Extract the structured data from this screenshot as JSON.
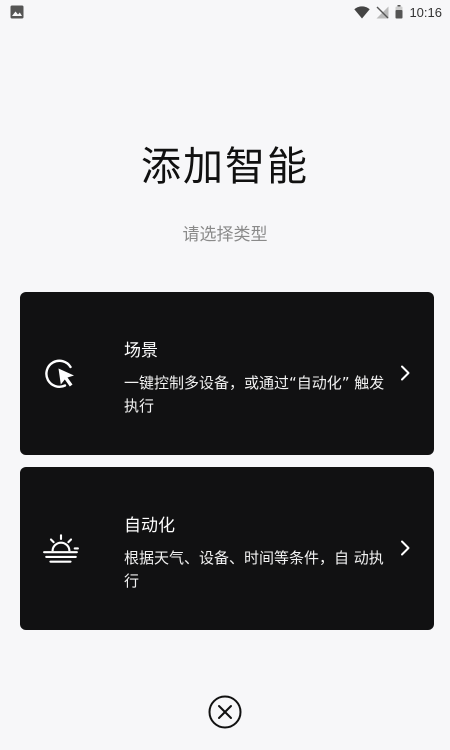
{
  "status_bar": {
    "time": "10:16",
    "icons": [
      "image-notification-icon",
      "wifi-icon",
      "no-signal-icon",
      "battery-icon"
    ]
  },
  "header": {
    "title": "添加智能",
    "subtitle": "请选择类型"
  },
  "options": [
    {
      "title": "场景",
      "description": "一键控制多设备，或通过“自动化” 触发执行",
      "icon": "cursor-click-icon"
    },
    {
      "title": "自动化",
      "description": "根据天气、设备、时间等条件，自 动执行",
      "icon": "sun-horizon-icon"
    }
  ],
  "footer": {
    "close_icon": "close-circle-icon"
  },
  "colors": {
    "background": "#f7f7f9",
    "card": "#111112",
    "text_primary": "#111111",
    "text_secondary": "#8a8a8a"
  }
}
